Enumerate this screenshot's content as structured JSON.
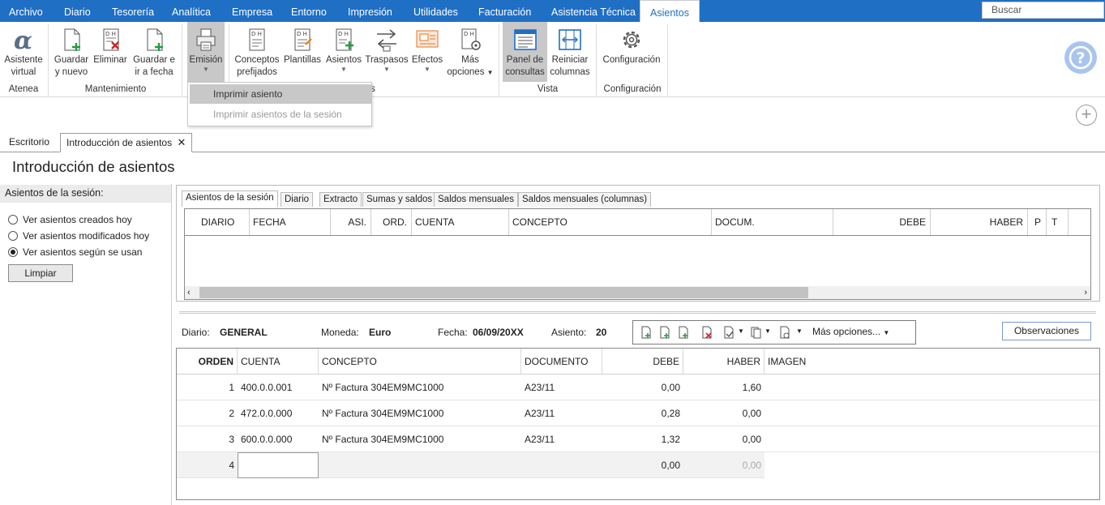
{
  "menu": {
    "tabs": [
      "Archivo",
      "Diario",
      "Tesorería",
      "Analítica",
      "Empresa",
      "Entorno",
      "Impresión",
      "Utilidades",
      "Facturación",
      "Asistencia Técnica",
      "Asientos"
    ],
    "active": "Asientos",
    "search_placeholder": "Buscar"
  },
  "ribbon": {
    "buttons": {
      "asistente": [
        "Asistente",
        "virtual"
      ],
      "guardar_nuevo": [
        "Guardar",
        "y nuevo"
      ],
      "eliminar": [
        "Eliminar",
        ""
      ],
      "guardar_fecha": [
        "Guardar e",
        "ir a fecha"
      ],
      "emision": [
        "Emisión",
        ""
      ],
      "conceptos": [
        "Conceptos",
        "prefijados"
      ],
      "plantillas": [
        "Plantillas",
        ""
      ],
      "asientos": [
        "Asientos",
        ""
      ],
      "traspasos": [
        "Traspasos",
        ""
      ],
      "efectos": [
        "Efectos",
        ""
      ],
      "mas_opciones": [
        "Más",
        "opciones"
      ],
      "panel": [
        "Panel de",
        "consultas"
      ],
      "reiniciar": [
        "Reiniciar",
        "columnas"
      ],
      "configuracion": [
        "Configuración",
        ""
      ]
    },
    "groups": {
      "atenea": "Atenea",
      "mantenimiento": "Mantenimiento",
      "s_partial": "s",
      "vista": "Vista",
      "configuracion": "Configuración"
    }
  },
  "dropdown": {
    "items": [
      "Imprimir asiento",
      "Imprimir asientos de la sesión"
    ]
  },
  "page_tabs": [
    "Escritorio",
    "Introducción de asientos"
  ],
  "page_title": "Introducción de asientos",
  "session": {
    "header": "Asientos de la sesión:",
    "options": [
      "Ver asientos creados hoy",
      "Ver asientos modificados hoy",
      "Ver asientos según se usan"
    ],
    "selected_index": 2,
    "clear_button": "Limpiar"
  },
  "inner_tabs": [
    "Asientos de la sesión",
    "Diario",
    "Extracto",
    "Sumas y saldos",
    "Saldos mensuales",
    "Saldos mensuales (columnas)"
  ],
  "upper_grid": {
    "columns": [
      "DIARIO",
      "FECHA",
      "ASI.",
      "ORD.",
      "CUENTA",
      "CONCEPTO",
      "DOCUM.",
      "DEBE",
      "HABER",
      "P",
      "T"
    ]
  },
  "entry": {
    "diario_label": "Diario:",
    "diario": "GENERAL",
    "moneda_label": "Moneda:",
    "moneda": "Euro",
    "fecha_label": "Fecha:",
    "fecha": "06/09/20XX",
    "asiento_label": "Asiento:",
    "asiento": "20",
    "more_options": "Más opciones...",
    "observaciones": "Observaciones"
  },
  "lines": {
    "columns": [
      "ORDEN",
      "CUENTA",
      "CONCEPTO",
      "DOCUMENTO",
      "DEBE",
      "HABER",
      "IMAGEN"
    ],
    "rows": [
      {
        "orden": "1",
        "cuenta": "400.0.0.001",
        "concepto": "Nº Factura 304EM9MC1000",
        "documento": "A23/11",
        "debe": "0,00",
        "haber": "1,60"
      },
      {
        "orden": "2",
        "cuenta": "472.0.0.000",
        "concepto": "Nº Factura 304EM9MC1000",
        "documento": "A23/11",
        "debe": "0,28",
        "haber": "0,00"
      },
      {
        "orden": "3",
        "cuenta": "600.0.0.000",
        "concepto": "Nº Factura 304EM9MC1000",
        "documento": "A23/11",
        "debe": "1,32",
        "haber": "0,00"
      },
      {
        "orden": "4",
        "cuenta": "",
        "concepto": "",
        "documento": "",
        "debe": "0,00",
        "haber": "0,00"
      }
    ]
  },
  "colors": {
    "brand": "#1f6fc5",
    "help": "#a9c4ee",
    "selected": "#c8c8c8"
  }
}
